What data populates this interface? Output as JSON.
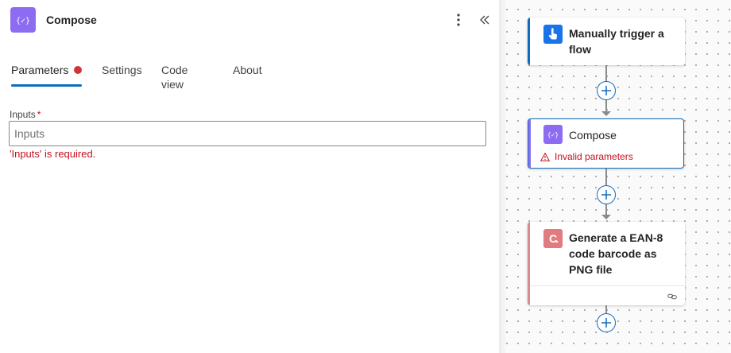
{
  "panel": {
    "title": "Compose",
    "tabs": [
      {
        "label": "Parameters",
        "active": true,
        "has_error": true
      },
      {
        "label": "Settings"
      },
      {
        "label": "Code view"
      },
      {
        "label": "About"
      }
    ],
    "field": {
      "label": "Inputs",
      "required_mark": "*",
      "placeholder": "Inputs",
      "value": "",
      "error": "'Inputs' is required."
    }
  },
  "canvas": {
    "cards": [
      {
        "title": "Manually trigger a flow",
        "icon": "hand-pointer-icon",
        "accent": "#0f6cbd"
      },
      {
        "title": "Compose",
        "icon": "compose-braces-icon",
        "accent": "#8c6cf0",
        "warning": "Invalid parameters",
        "selected": true
      },
      {
        "title": "Generate a EAN-8 code barcode as PNG file",
        "icon": "barcode-connector-icon",
        "accent": "#d88a8f"
      }
    ]
  },
  "colors": {
    "brand": "#0f6cbd",
    "error": "#c50f1f",
    "compose": "#8c6cf0"
  }
}
